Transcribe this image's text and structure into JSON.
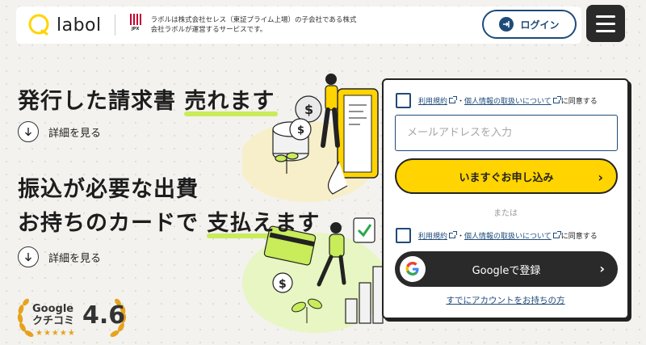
{
  "header": {
    "logo_text": "labol",
    "jpx_label": "JPX",
    "note": "ラボルは株式会社セレス（東証プライム上場）の子会社である株式会社ラボルが運営するサービスです。",
    "login_label": "ログイン",
    "menu_icon": "hamburger-icon"
  },
  "hero": {
    "headline1_plain": "発行した請求書",
    "headline1_em": "売れます",
    "detail1": "詳細を見る",
    "headline2": "振込が必要な出費",
    "headline3_plain": "お持ちのカードで",
    "headline3_em": "支払えます",
    "detail2": "詳細を見る"
  },
  "rating": {
    "label_line1": "Google",
    "label_line2": "クチコミ",
    "score": "4.6",
    "stars": "★★★★★"
  },
  "form": {
    "terms_link": "利用規約",
    "separator": "・",
    "privacy_link": "個人情報の取扱いについて",
    "agree_suffix": "に同意する",
    "email_placeholder": "メールアドレスを入力",
    "email_value": "",
    "apply_label": "いますぐお申し込み",
    "or_label": "または",
    "google_label": "Googleで登録",
    "account_link": "すでにアカウントをお持ちの方"
  },
  "colors": {
    "accent_yellow": "#ffd400",
    "brand_navy": "#1f4b7a",
    "highlight_green": "#c8ec5a",
    "dark": "#2a2a2a"
  }
}
